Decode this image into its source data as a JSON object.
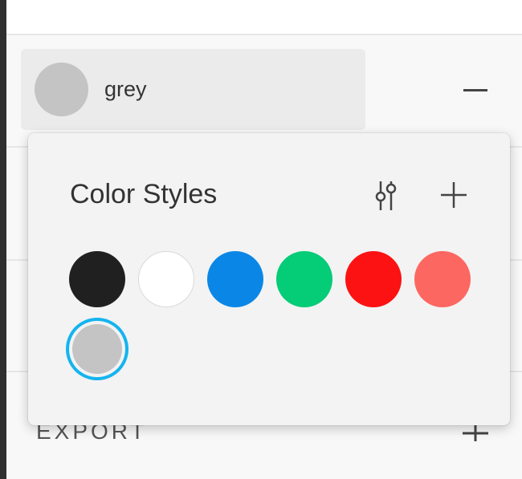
{
  "fill": {
    "style_name": "grey",
    "swatch_color": "#c4c4c4",
    "remove_icon": "minus-icon"
  },
  "export": {
    "label": "EXPORT",
    "add_icon": "plus-icon"
  },
  "color_styles_popover": {
    "title": "Color Styles",
    "adjust_icon": "sliders-icon",
    "add_icon": "plus-icon",
    "selected_index": 6,
    "swatches": [
      {
        "color": "#202020"
      },
      {
        "color": "#ffffff"
      },
      {
        "color": "#0a87e6"
      },
      {
        "color": "#04cc77"
      },
      {
        "color": "#fc1212"
      },
      {
        "color": "#fd6761"
      },
      {
        "color": "#c4c4c4"
      }
    ],
    "selection_ring_color": "#14b4ef"
  }
}
